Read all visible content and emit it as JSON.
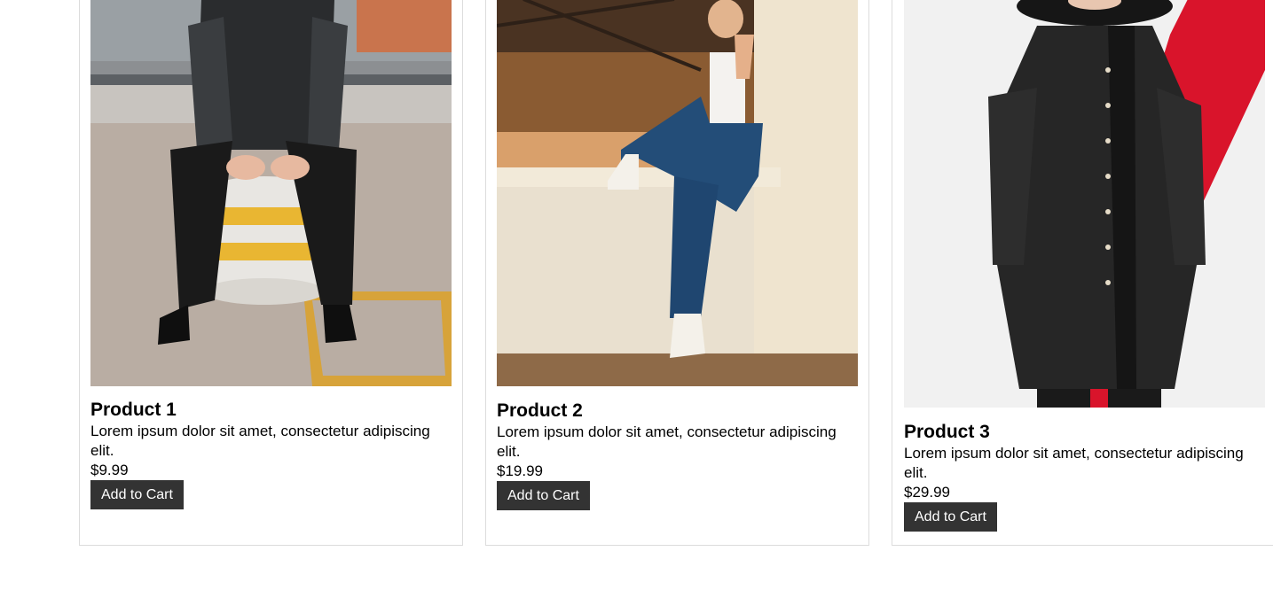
{
  "products": [
    {
      "title": "Product 1",
      "description": "Lorem ipsum dolor sit amet, consectetur adipiscing elit.",
      "price": "$9.99",
      "button": "Add to Cart"
    },
    {
      "title": "Product 2",
      "description": "Lorem ipsum dolor sit amet, consectetur adipiscing elit.",
      "price": "$19.99",
      "button": "Add to Cart"
    },
    {
      "title": "Product 3",
      "description": "Lorem ipsum dolor sit amet, consectetur adipiscing elit.",
      "price": "$29.99",
      "button": "Add to Cart"
    }
  ],
  "colors": {
    "button_bg": "#333333",
    "button_text": "#ffffff",
    "card_border": "#dcdcdc",
    "accent_red": "#d9142b"
  }
}
